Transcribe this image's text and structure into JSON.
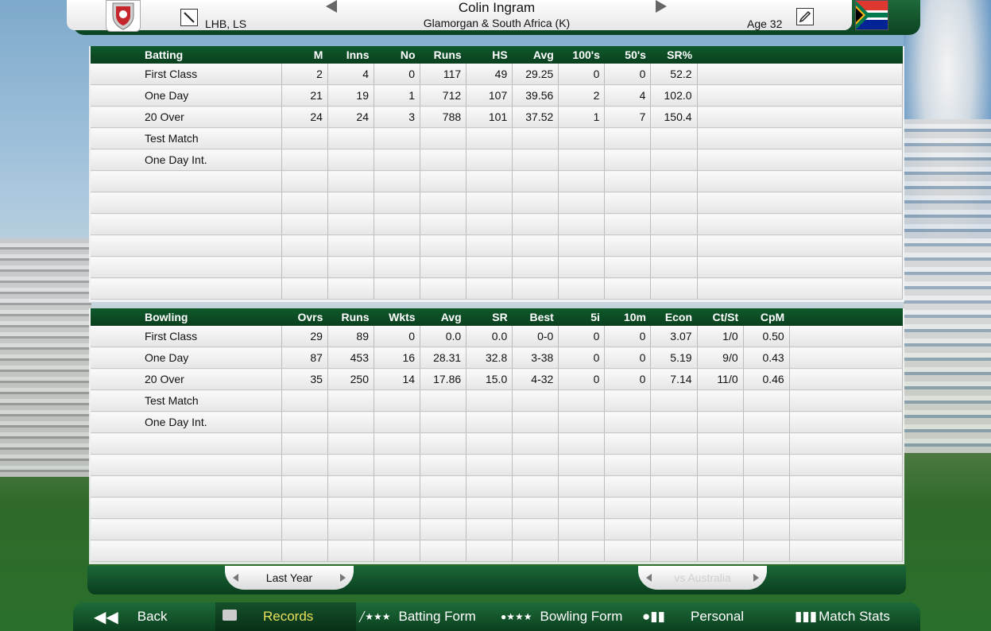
{
  "header": {
    "hand": "LHB, LS",
    "player_name": "Colin Ingram",
    "team": "Glamorgan & South Africa (K)",
    "age": "Age 32"
  },
  "batting": {
    "headers": [
      "Batting",
      "M",
      "Inns",
      "No",
      "Runs",
      "HS",
      "Avg",
      "100's",
      "50's",
      "SR%"
    ],
    "rows": [
      [
        "First Class",
        "2",
        "4",
        "0",
        "117",
        "49",
        "29.25",
        "0",
        "0",
        "52.2"
      ],
      [
        "One Day",
        "21",
        "19",
        "1",
        "712",
        "107",
        "39.56",
        "2",
        "4",
        "102.0"
      ],
      [
        "20 Over",
        "24",
        "24",
        "3",
        "788",
        "101",
        "37.52",
        "1",
        "7",
        "150.4"
      ],
      [
        "Test Match",
        "",
        "",
        "",
        "",
        "",
        "",
        "",
        "",
        ""
      ],
      [
        "One Day Int.",
        "",
        "",
        "",
        "",
        "",
        "",
        "",
        "",
        ""
      ]
    ]
  },
  "bowling": {
    "headers": [
      "Bowling",
      "Ovrs",
      "Runs",
      "Wkts",
      "Avg",
      "SR",
      "Best",
      "5i",
      "10m",
      "Econ",
      "Ct/St",
      "CpM"
    ],
    "rows": [
      [
        "First Class",
        "29",
        "89",
        "0",
        "0.0",
        "0.0",
        "0-0",
        "0",
        "0",
        "3.07",
        "1/0",
        "0.50"
      ],
      [
        "One Day",
        "87",
        "453",
        "16",
        "28.31",
        "32.8",
        "3-38",
        "0",
        "0",
        "5.19",
        "9/0",
        "0.43"
      ],
      [
        "20 Over",
        "35",
        "250",
        "14",
        "17.86",
        "15.0",
        "4-32",
        "0",
        "0",
        "7.14",
        "11/0",
        "0.46"
      ],
      [
        "Test Match",
        "",
        "",
        "",
        "",
        "",
        "",
        "",
        "",
        "",
        "",
        ""
      ],
      [
        "One Day Int.",
        "",
        "",
        "",
        "",
        "",
        "",
        "",
        "",
        "",
        "",
        ""
      ]
    ]
  },
  "selectors": {
    "period": "Last Year",
    "opponent": "vs Australia"
  },
  "nav": {
    "back": "Back",
    "records": "Records",
    "batting_form": "Batting Form",
    "bowling_form": "Bowling Form",
    "personal": "Personal",
    "match_stats": "Match Stats"
  },
  "colors": {
    "header_green": "#0f5a2c",
    "active_nav_text": "#e8e05a"
  }
}
